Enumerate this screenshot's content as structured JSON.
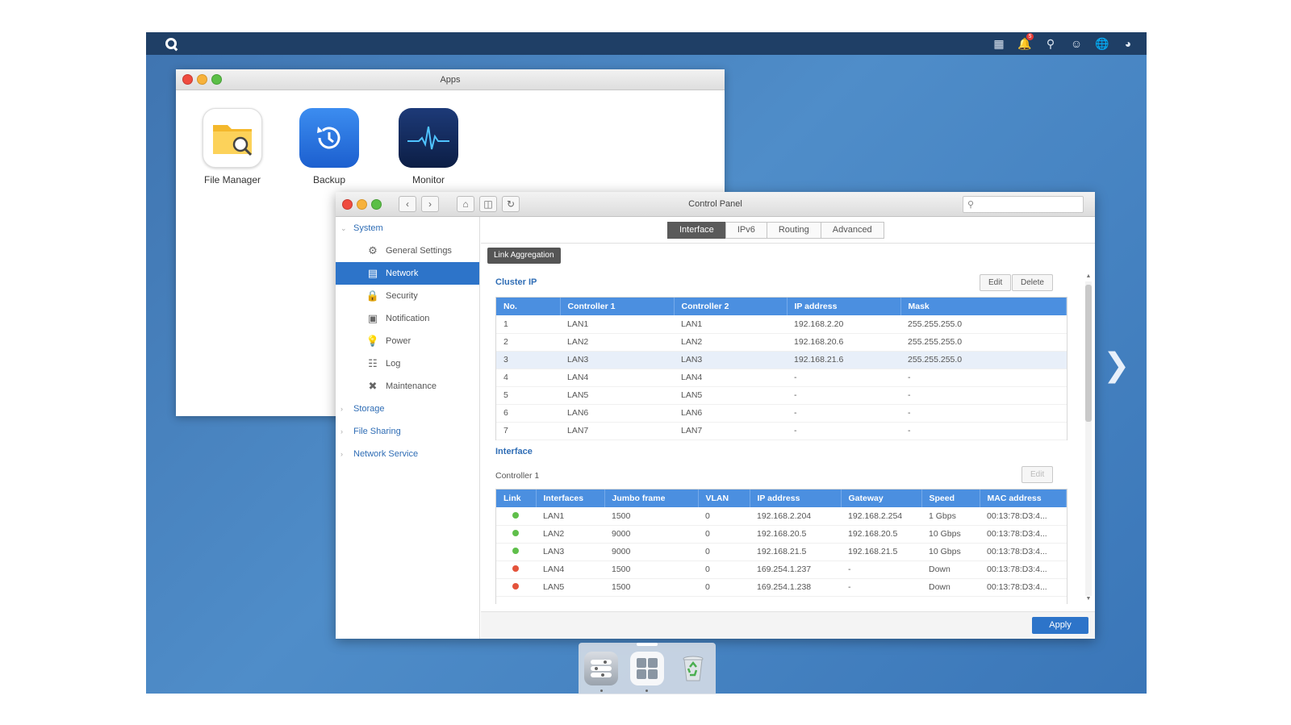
{
  "desktop": {
    "notification_count": "5",
    "tray_icons": [
      "apps-grid-icon",
      "bell-icon",
      "search-icon",
      "user-icon",
      "globe-icon",
      "dashboard-icon"
    ]
  },
  "apps_window": {
    "title": "Apps",
    "apps": [
      {
        "label": "File Manager",
        "icon": "file-manager-icon"
      },
      {
        "label": "Backup",
        "icon": "backup-icon"
      },
      {
        "label": "Monitor",
        "icon": "monitor-icon"
      }
    ]
  },
  "control_panel": {
    "title": "Control Panel",
    "search_placeholder": "",
    "sidebar": {
      "system": "System",
      "items": [
        {
          "label": "General Settings",
          "icon": "gear-icon"
        },
        {
          "label": "Network",
          "icon": "network-icon",
          "active": true
        },
        {
          "label": "Security",
          "icon": "lock-icon"
        },
        {
          "label": "Notification",
          "icon": "notification-icon"
        },
        {
          "label": "Power",
          "icon": "bulb-icon"
        },
        {
          "label": "Log",
          "icon": "log-icon"
        },
        {
          "label": "Maintenance",
          "icon": "tools-icon"
        }
      ],
      "groups": [
        "Storage",
        "File Sharing",
        "Network Service"
      ]
    },
    "tabs": [
      "Interface",
      "IPv6",
      "Routing",
      "Advanced"
    ],
    "active_tab": "Interface",
    "link_aggregation": "Link Aggregation",
    "cluster_ip": {
      "title": "Cluster IP",
      "edit": "Edit",
      "delete": "Delete",
      "columns": [
        "No.",
        "Controller 1",
        "Controller 2",
        "IP address",
        "Mask"
      ],
      "rows": [
        [
          "1",
          "LAN1",
          "LAN1",
          "192.168.2.20",
          "255.255.255.0"
        ],
        [
          "2",
          "LAN2",
          "LAN2",
          "192.168.20.6",
          "255.255.255.0"
        ],
        [
          "3",
          "LAN3",
          "LAN3",
          "192.168.21.6",
          "255.255.255.0"
        ],
        [
          "4",
          "LAN4",
          "LAN4",
          "-",
          "-"
        ],
        [
          "5",
          "LAN5",
          "LAN5",
          "-",
          "-"
        ],
        [
          "6",
          "LAN6",
          "LAN6",
          "-",
          "-"
        ],
        [
          "7",
          "LAN7",
          "LAN7",
          "-",
          "-"
        ]
      ],
      "highlighted_row": 2
    },
    "interface": {
      "title": "Interface",
      "controller_label": "Controller 1",
      "edit": "Edit",
      "columns": [
        "Link",
        "Interfaces",
        "Jumbo frame",
        "VLAN",
        "IP address",
        "Gateway",
        "Speed",
        "MAC address"
      ],
      "rows": [
        {
          "status": "up",
          "cells": [
            "LAN1",
            "1500",
            "0",
            "192.168.2.204",
            "192.168.2.254",
            "1 Gbps",
            "00:13:78:D3:4..."
          ]
        },
        {
          "status": "up",
          "cells": [
            "LAN2",
            "9000",
            "0",
            "192.168.20.5",
            "192.168.20.5",
            "10 Gbps",
            "00:13:78:D3:4..."
          ]
        },
        {
          "status": "up",
          "cells": [
            "LAN3",
            "9000",
            "0",
            "192.168.21.5",
            "192.168.21.5",
            "10 Gbps",
            "00:13:78:D3:4..."
          ]
        },
        {
          "status": "down",
          "cells": [
            "LAN4",
            "1500",
            "0",
            "169.254.1.237",
            "-",
            "Down",
            "00:13:78:D3:4..."
          ]
        },
        {
          "status": "down",
          "cells": [
            "LAN5",
            "1500",
            "0",
            "169.254.1.238",
            "-",
            "Down",
            "00:13:78:D3:4..."
          ]
        }
      ]
    },
    "apply": "Apply"
  },
  "dock": {
    "items": [
      "control-panel-icon",
      "app-center-icon",
      "recycle-bin-icon"
    ]
  },
  "colors": {
    "accent": "#2d74c9",
    "table_header": "#4b8fe0",
    "link_up": "#5fbf4a",
    "link_down": "#e4533b"
  }
}
